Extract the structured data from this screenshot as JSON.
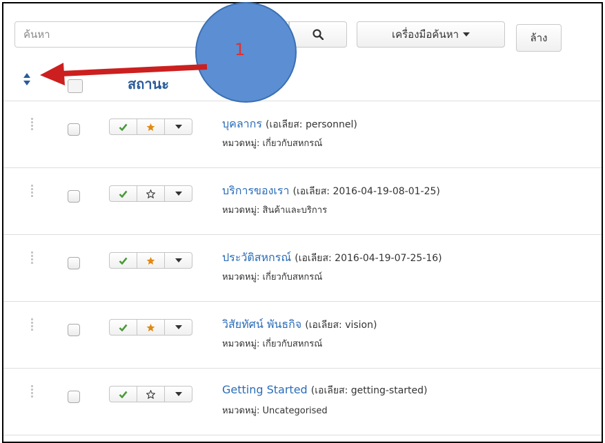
{
  "toolbar": {
    "search_placeholder": "ค้นหา",
    "search_tools_label": "เครื่องมือค้นหา",
    "clear_label": "ล้าง"
  },
  "table_header": {
    "status_label": "สถานะ"
  },
  "callout": {
    "number": "1",
    "circle_color": "#5b8ed2",
    "arrow_color": "#cc1f1f"
  },
  "colors": {
    "published": "#4a9a3a",
    "featured": "#e08a14",
    "link": "#2a6cb8"
  },
  "rows": [
    {
      "title": "บุคลากร",
      "alias": "(เอเลียส: personnel)",
      "category": "หมวดหมู่: เกี่ยวกับสหกรณ์",
      "published": true,
      "featured": true
    },
    {
      "title": "บริการของเรา",
      "alias": "(เอเลียส: 2016-04-19-08-01-25)",
      "category": "หมวดหมู่: สินค้าและบริการ",
      "published": true,
      "featured": false
    },
    {
      "title": "ประวัติสหกรณ์",
      "alias": "(เอเลียส: 2016-04-19-07-25-16)",
      "category": "หมวดหมู่: เกี่ยวกับสหกรณ์",
      "published": true,
      "featured": true
    },
    {
      "title": "วิสัยทัศน์ พันธกิจ",
      "alias": "(เอเลียส: vision)",
      "category": "หมวดหมู่: เกี่ยวกับสหกรณ์",
      "published": true,
      "featured": true
    },
    {
      "title": "Getting Started",
      "alias": "(เอเลียส: getting-started)",
      "category": "หมวดหมู่: Uncategorised",
      "published": true,
      "featured": false
    }
  ]
}
